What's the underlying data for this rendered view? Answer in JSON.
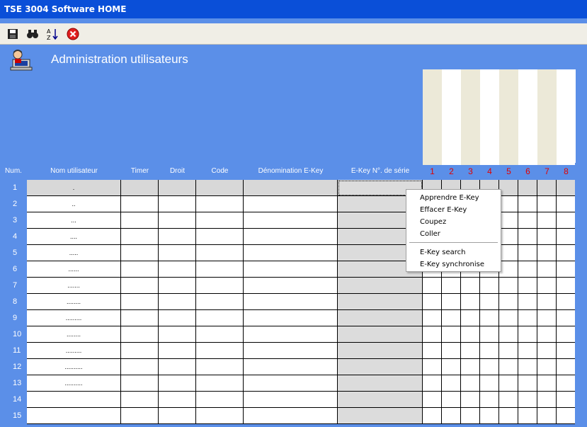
{
  "window": {
    "title": "TSE 3004 Software HOME"
  },
  "toolbar": {
    "buttons": [
      {
        "name": "save-button",
        "icon": "floppy-disk-icon"
      },
      {
        "name": "find-button",
        "icon": "binoculars-icon"
      },
      {
        "name": "sort-button",
        "icon": "sort-az-icon"
      },
      {
        "name": "close-button",
        "icon": "close-circle-icon"
      }
    ]
  },
  "page": {
    "title": "Administration utilisateurs"
  },
  "table": {
    "headers": {
      "num": "Num.",
      "nom": "Nom utilisateur",
      "timer": "Timer",
      "droit": "Droit",
      "code": "Code",
      "denomination": "Dénomination E-Key",
      "serie": "E-Key N°. de série"
    },
    "slot_headers": [
      "1",
      "2",
      "3",
      "4",
      "5",
      "6",
      "7",
      "8"
    ],
    "rows": [
      {
        "num": "1",
        "nom": "."
      },
      {
        "num": "2",
        "nom": ".."
      },
      {
        "num": "3",
        "nom": "..."
      },
      {
        "num": "4",
        "nom": "...."
      },
      {
        "num": "5",
        "nom": "....."
      },
      {
        "num": "6",
        "nom": "......"
      },
      {
        "num": "7",
        "nom": "......."
      },
      {
        "num": "8",
        "nom": "........"
      },
      {
        "num": "9",
        "nom": "........."
      },
      {
        "num": "10",
        "nom": "........"
      },
      {
        "num": "11",
        "nom": "........."
      },
      {
        "num": "12",
        "nom": ".........."
      },
      {
        "num": "13",
        "nom": ".........."
      },
      {
        "num": "14",
        "nom": ""
      },
      {
        "num": "15",
        "nom": ""
      }
    ]
  },
  "context_menu": {
    "items": [
      "Apprendre E-Key",
      "Effacer E-Key",
      "Coupez",
      "Coller"
    ],
    "items2": [
      "E-Key search",
      "E-Key synchronise"
    ]
  },
  "colors": {
    "background": "#5b8fe8",
    "titlebar": "#0a4fd8",
    "slot_header": "#e00000"
  }
}
